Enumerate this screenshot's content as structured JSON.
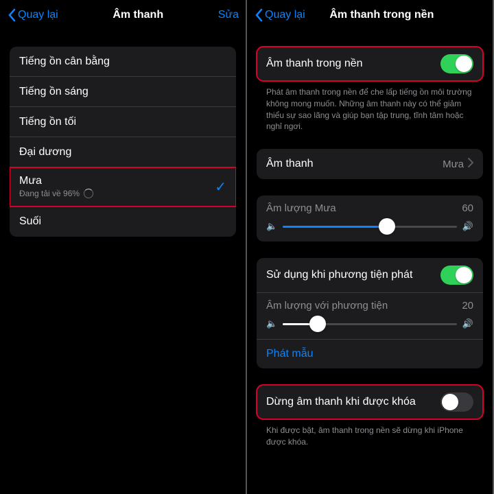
{
  "left": {
    "back": "Quay lại",
    "title": "Âm thanh",
    "edit": "Sửa",
    "sounds": [
      {
        "label": "Tiếng ồn cân bằng"
      },
      {
        "label": "Tiếng ồn sáng"
      },
      {
        "label": "Tiếng ồn tối"
      },
      {
        "label": "Đại dương"
      },
      {
        "label": "Mưa",
        "sub": "Đang tải về 96%",
        "selected": true,
        "highlight": true
      },
      {
        "label": "Suối"
      }
    ]
  },
  "right": {
    "back": "Quay lại",
    "title": "Âm thanh trong nền",
    "bgsound": {
      "label": "Âm thanh trong nền",
      "on": true,
      "desc": "Phát âm thanh trong nền để che lấp tiếng ồn môi trường không mong muốn. Những âm thanh này có thể giảm thiểu sự sao lãng và giúp bạn tập trung, tĩnh tâm hoặc nghỉ ngơi."
    },
    "sound_select": {
      "label": "Âm thanh",
      "value": "Mưa"
    },
    "volume": {
      "label": "Âm lượng Mưa",
      "value": 60
    },
    "media": {
      "use_label": "Sử dụng khi phương tiện phát",
      "use_on": true,
      "vol_label": "Âm lượng với phương tiện",
      "vol_value": 20,
      "sample": "Phát mẫu"
    },
    "stop_locked": {
      "label": "Dừng âm thanh khi được khóa",
      "on": false,
      "desc": "Khi được bật, âm thanh trong nền sẽ dừng khi iPhone được khóa."
    }
  }
}
